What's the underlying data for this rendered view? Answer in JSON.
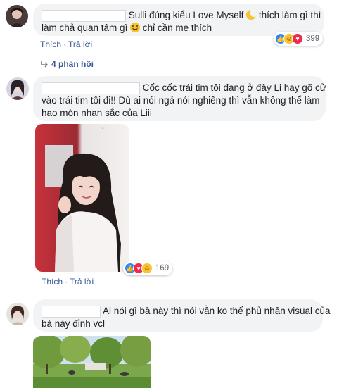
{
  "comments": [
    {
      "text_part1": "Sulli đúng kiểu Love Myself",
      "text_part2": "thích làm gì thì",
      "text_line2a": "làm chả quan tâm gì",
      "text_line2b": "chỉ cần mẹ thích",
      "actions": {
        "like": "Thích",
        "reply": "Trả lời"
      },
      "reaction_count": "399",
      "reply_count": "4 phản hồi"
    },
    {
      "text_line1": "Cốc cốc trái tim tôi đang ở đây Li hay gõ cử",
      "text_line2": "vào trái tim tôi đi!! Dù ai nói ngả nói nghiêng thì vẫn không thể làm",
      "text_line3": "hao mòn nhan sắc của Liii",
      "actions": {
        "like": "Thích",
        "reply": "Trả lời"
      },
      "reaction_count": "169"
    },
    {
      "text_line1": "Ai nói gì bà này thì nói vẫn ko thể phủ nhận visual của",
      "text_line2": "bà này đỉnh vcl"
    }
  ],
  "icons": {
    "like": "like-icon",
    "love": "love-icon",
    "haha": "haha-icon",
    "emoji_moon": "crescent-moon-face-icon",
    "emoji_smile": "smiling-face-icon",
    "reply_arrow": "reply-arrow-icon"
  },
  "colors": {
    "link": "#385898",
    "bubble": "#f2f3f5",
    "like": "#2d88ff",
    "love": "#f0284a",
    "haha": "#f7c331"
  }
}
